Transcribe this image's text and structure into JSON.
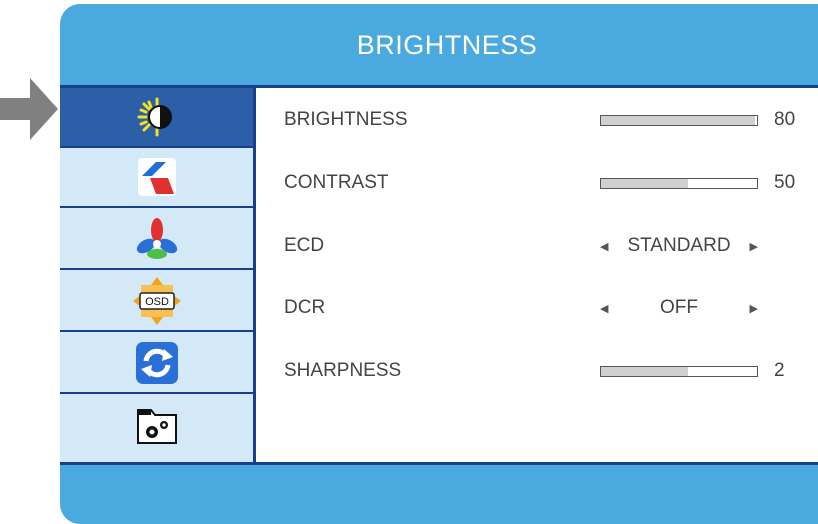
{
  "window": {
    "title": "BRIGHTNESS"
  },
  "sidebar": {
    "items": [
      {
        "icon": "brightness-icon",
        "active": true
      },
      {
        "icon": "image-icon",
        "active": false
      },
      {
        "icon": "color-icon",
        "active": false
      },
      {
        "icon": "osd-icon",
        "label": "OSD",
        "active": false
      },
      {
        "icon": "reset-icon",
        "active": false
      },
      {
        "icon": "settings-folder-icon",
        "active": false
      }
    ]
  },
  "settings": [
    {
      "label": "BRIGHTNESS",
      "type": "slider",
      "value": "80",
      "level": 0.99
    },
    {
      "label": "CONTRAST",
      "type": "slider",
      "value": "50",
      "level": 0.56
    },
    {
      "label": "ECD",
      "type": "select",
      "value": "STANDARD"
    },
    {
      "label": "DCR",
      "type": "select",
      "value": "OFF"
    },
    {
      "label": "SHARPNESS",
      "type": "slider",
      "value": "2",
      "level": 0.56
    }
  ],
  "colors": {
    "frame": "#4aa9df",
    "sidebar": "#d3e9f7",
    "active": "#2c5fa8",
    "border": "#173f8a",
    "pointer": "#808080"
  }
}
